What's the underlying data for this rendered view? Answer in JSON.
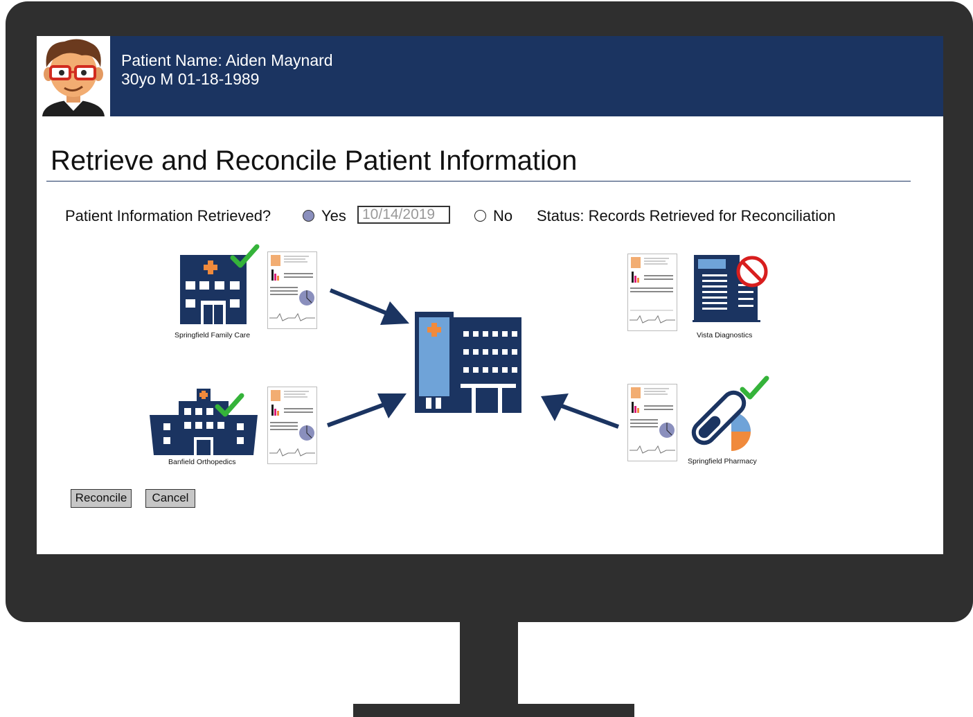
{
  "patient": {
    "name_line": "Patient Name: Aiden Maynard",
    "info_line": "30yo M  01-18-1989"
  },
  "page_title": "Retrieve and Reconcile Patient Information",
  "retrieval": {
    "question": "Patient Information Retrieved?",
    "yes_label": "Yes",
    "yes_selected": true,
    "date_value": "10/14/2019",
    "no_label": "No",
    "no_selected": false,
    "status_text": "Status: Records Retrieved for Reconciliation"
  },
  "sources": [
    {
      "name": "Springfield Family Care",
      "status_icon": "check-icon",
      "icon": "hospital-icon"
    },
    {
      "name": "Banfield Orthopedics",
      "status_icon": "check-icon",
      "icon": "hospital-icon"
    },
    {
      "name": "Vista Diagnostics",
      "status_icon": "prohibited-icon",
      "icon": "building-icon"
    },
    {
      "name": "Springfield Pharmacy",
      "status_icon": "check-icon",
      "icon": "pill-icon"
    }
  ],
  "central_icon": "hospital-icon",
  "buttons": {
    "reconcile": "Reconcile",
    "cancel": "Cancel"
  },
  "colors": {
    "header_bg": "#1b3461",
    "navy": "#1b3461",
    "accent_orange": "#f08a3c",
    "check_green": "#35b33a",
    "prohibit_red": "#d81e1e",
    "light_blue": "#6fa3d8"
  }
}
